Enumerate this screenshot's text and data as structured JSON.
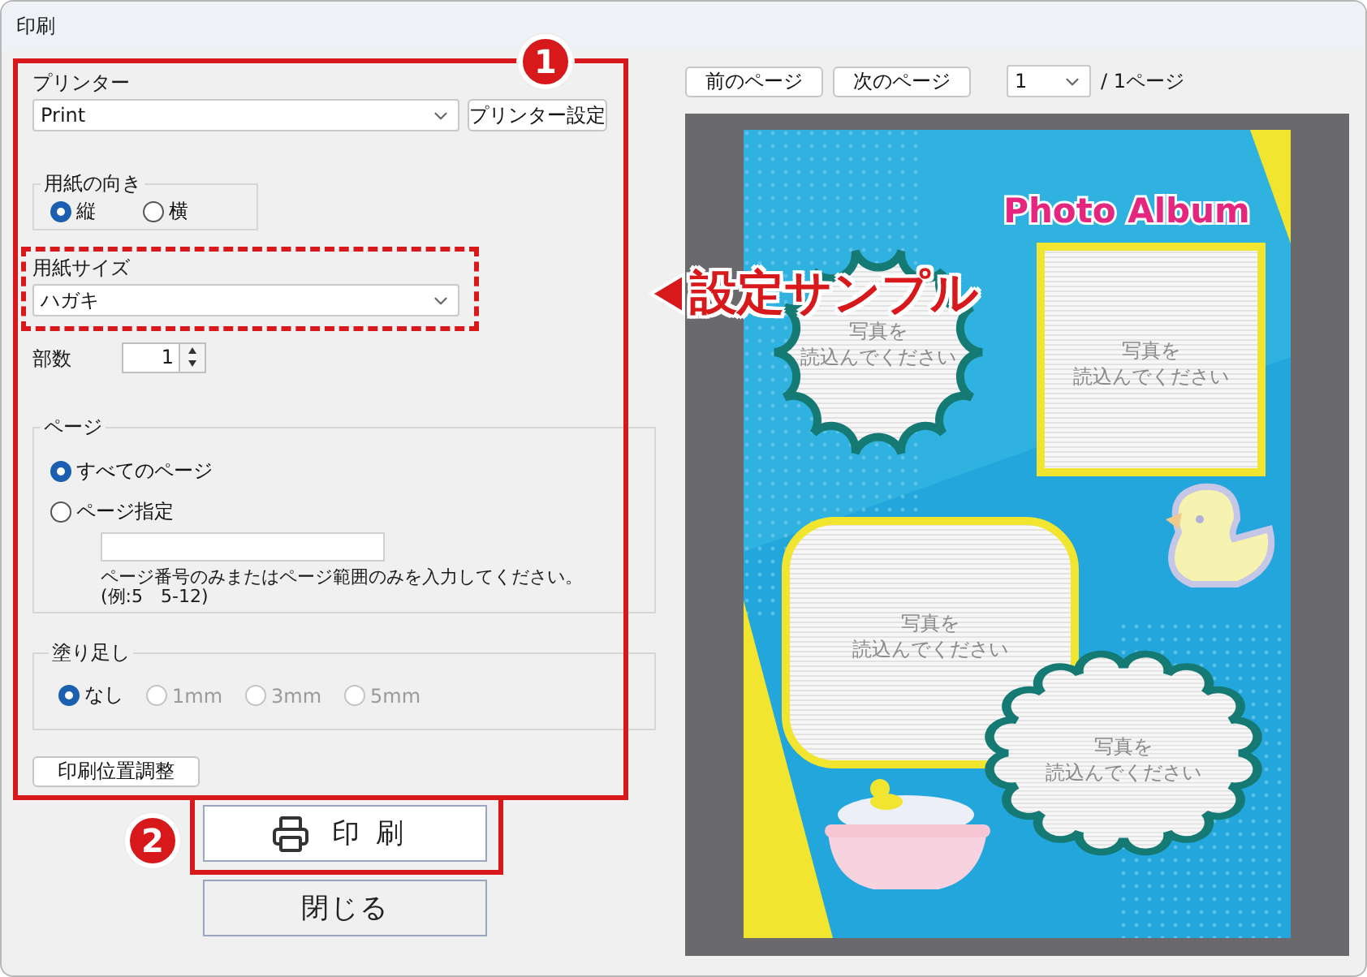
{
  "window": {
    "title": "印刷"
  },
  "printer": {
    "label": "プリンター",
    "value": "Print",
    "settings_button": "プリンター設定"
  },
  "orientation": {
    "label": "用紙の向き",
    "options": [
      {
        "label": "縦",
        "selected": true
      },
      {
        "label": "横",
        "selected": false
      }
    ]
  },
  "paper_size": {
    "label": "用紙サイズ",
    "value": "ハガキ"
  },
  "copies": {
    "label": "部数",
    "value": "1"
  },
  "pages": {
    "label": "ページ",
    "options": [
      {
        "label": "すべてのページ",
        "selected": true
      },
      {
        "label": "ページ指定",
        "selected": false
      }
    ],
    "help": "ページ番号のみまたはページ範囲のみを入力してください。",
    "example": "(例:5　5-12)"
  },
  "bleed": {
    "label": "塗り足し",
    "options": [
      {
        "label": "なし",
        "selected": true,
        "disabled": false
      },
      {
        "label": "1mm",
        "selected": false,
        "disabled": true
      },
      {
        "label": "3mm",
        "selected": false,
        "disabled": true
      },
      {
        "label": "5mm",
        "selected": false,
        "disabled": true
      }
    ]
  },
  "position_button": "印刷位置調整",
  "print_button": "印刷",
  "close_button": "閉じる",
  "preview": {
    "prev_button": "前のページ",
    "next_button": "次のページ",
    "page_select": "1",
    "page_total": "/ 1ページ",
    "template": {
      "title": "Photo Album",
      "frames": [
        {
          "kind": "burst",
          "lines": [
            "写真を",
            "読込んでください"
          ]
        },
        {
          "kind": "square",
          "lines": [
            "写真を",
            "読込んでください"
          ]
        },
        {
          "kind": "rounded",
          "lines": [
            "写真を",
            "読込んでください"
          ]
        },
        {
          "kind": "cloud",
          "lines": [
            "写真を",
            "読込んでください"
          ]
        }
      ]
    }
  },
  "annotations": [
    {
      "kind": "number",
      "text": "1"
    },
    {
      "kind": "number",
      "text": "2"
    },
    {
      "kind": "callout",
      "text": "設定サンプル"
    }
  ]
}
